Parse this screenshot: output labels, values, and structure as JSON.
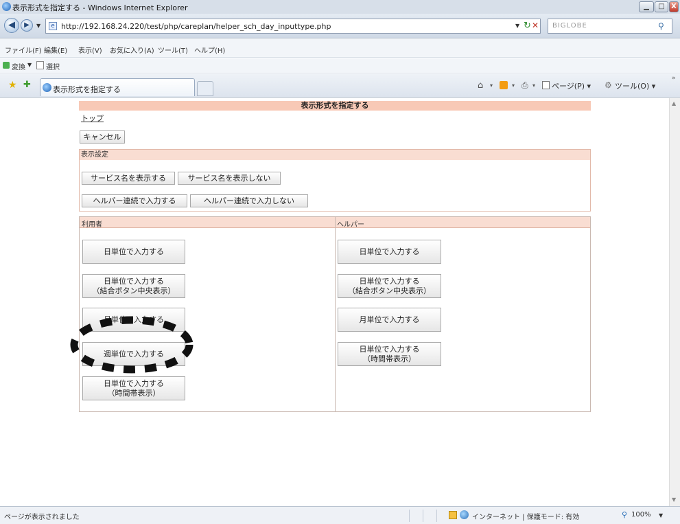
{
  "window": {
    "title": "表示形式を指定する - Windows Internet Explorer",
    "controls": {
      "minimize": "▁",
      "maximize": "□",
      "close": "X"
    }
  },
  "addressbar": {
    "url": "http://192.168.24.220/test/php/careplan/helper_sch_day_inputtype.php",
    "refresh_glyph": "↻",
    "stop_glyph": "✕",
    "search_placeholder": "BIGLOBE",
    "search_glyph": "⚲"
  },
  "menubar": {
    "items": [
      "ファイル(F)",
      "編集(E)",
      "表示(V)",
      "お気に入り(A)",
      "ツール(T)",
      "ヘルプ(H)"
    ]
  },
  "linksbar": {
    "convert_label": "変換",
    "select_label": "選択"
  },
  "tabbar": {
    "tab_title": "表示形式を指定する",
    "page_menu": "ページ(P) ▾",
    "tools_menu": "ツール(O) ▾"
  },
  "page": {
    "header": "表示形式を指定する",
    "top_link": "トップ",
    "cancel_button": "キャンセル",
    "display_settings": {
      "title": "表示設定",
      "show_service_name": "サービス名を表示する",
      "hide_service_name": "サービス名を表示しない",
      "helper_continuous_input": "ヘルパー連続で入力する",
      "helper_no_continuous_input": "ヘルパー連続で入力しない"
    },
    "user_column": {
      "title": "利用者",
      "buttons": [
        "日単位で入力する",
        "日単位で入力する\n（結合ボタン中央表示）",
        "月単位で入力する",
        "週単位で入力する",
        "日単位で入力する\n（時間帯表示）"
      ]
    },
    "helper_column": {
      "title": "ヘルパー",
      "buttons": [
        "日単位で入力する",
        "日単位で入力する\n（結合ボタン中央表示）",
        "月単位で入力する",
        "日単位で入力する\n（時間帯表示）"
      ]
    }
  },
  "statusbar": {
    "message": "ページが表示されました",
    "zone": "インターネット | 保護モード: 有効",
    "zoom": "100%"
  },
  "colors": {
    "page_header_bg": "#f8c9b6",
    "section_header_bg": "#f9ddd2",
    "annotation": "#111111"
  }
}
